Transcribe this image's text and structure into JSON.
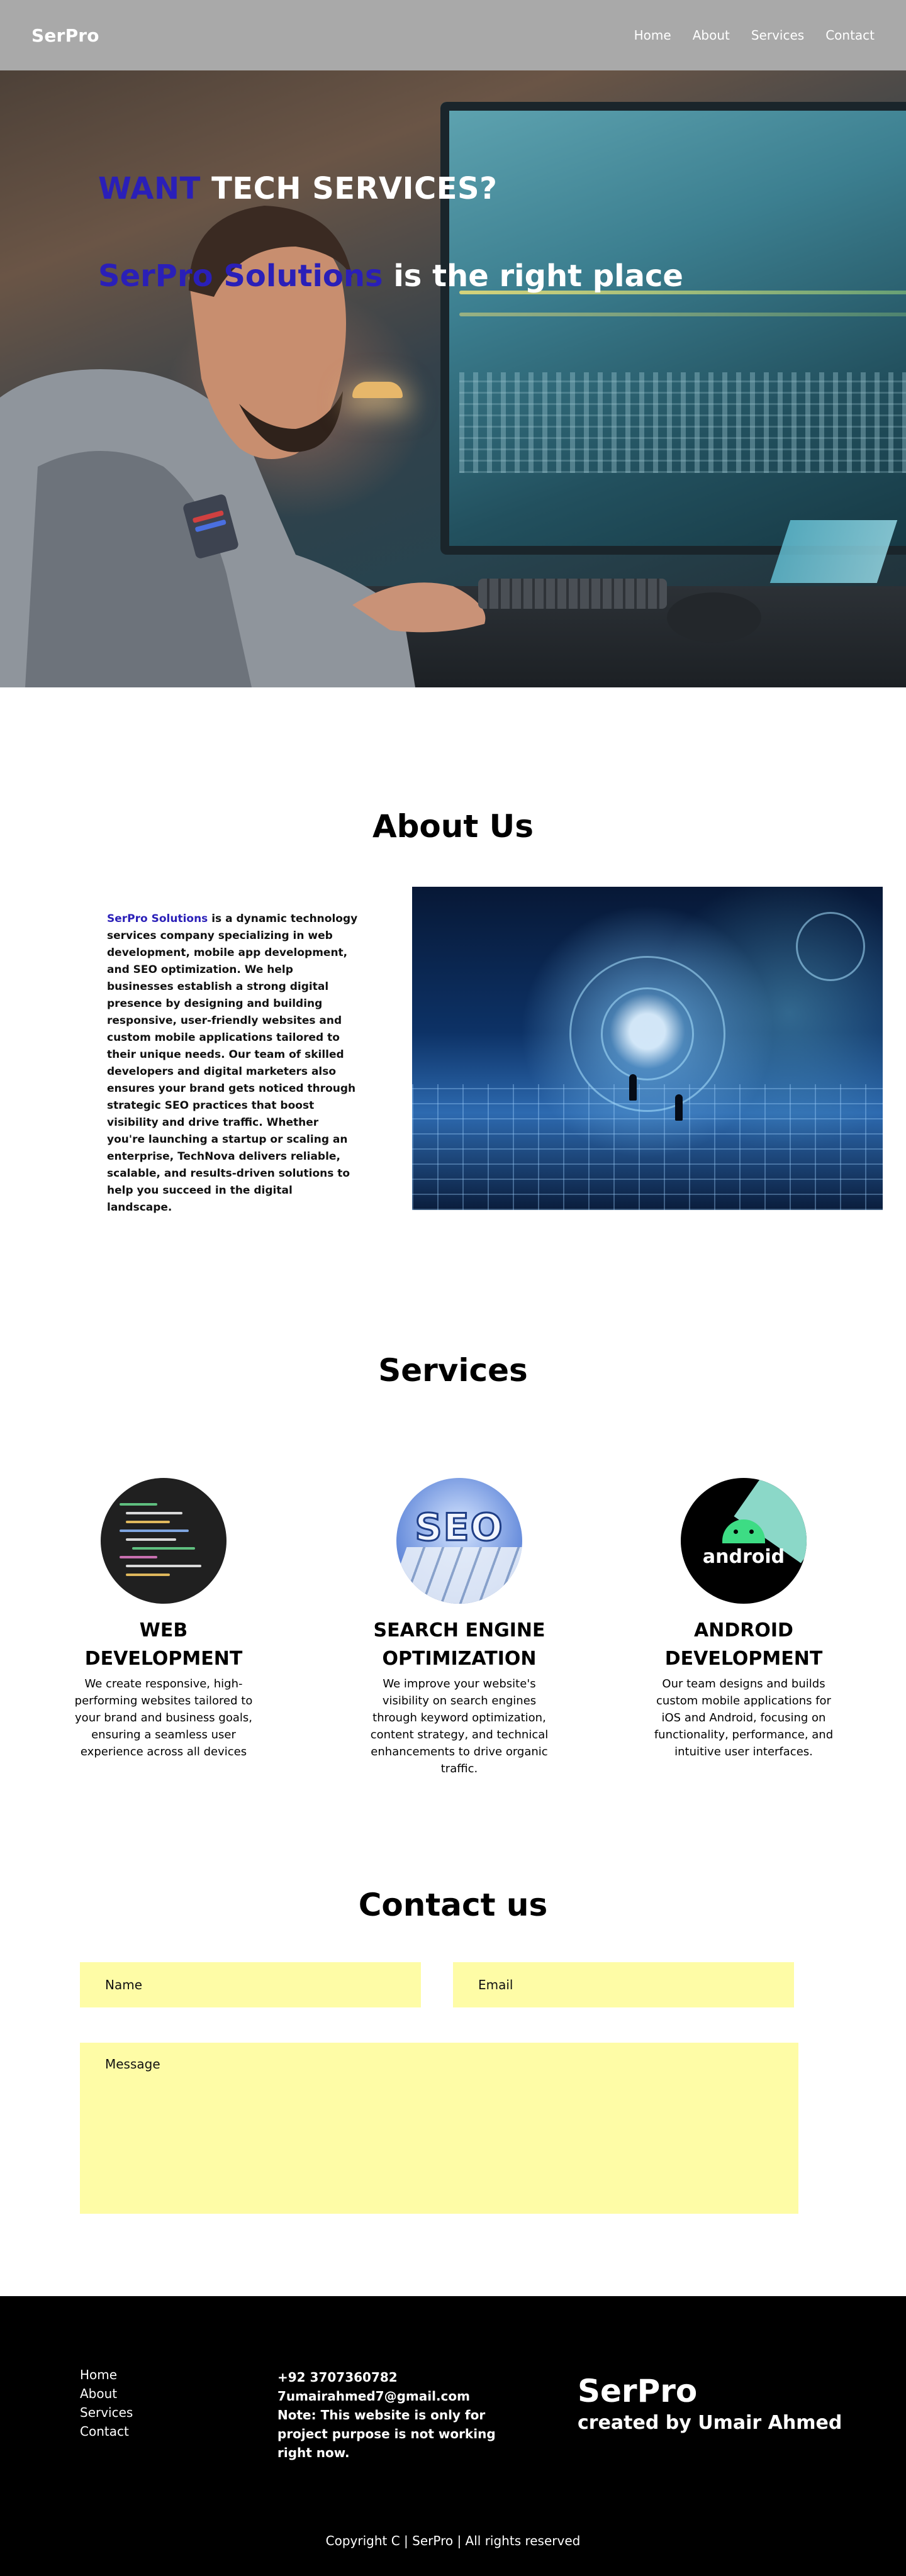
{
  "navbar": {
    "brand": "SerPro",
    "links": [
      "Home",
      "About",
      "Services",
      "Contact"
    ]
  },
  "hero": {
    "headline_accent": "WANT",
    "headline_rest": " TECH SERVICES?",
    "sub_accent": "SerPro Solutions",
    "sub_rest": " is the right place"
  },
  "about": {
    "title": "About Us",
    "accent": "SerPro Solutions",
    "text": " is a dynamic technology services company specializing in web development, mobile app development, and SEO optimization. We help businesses establish a strong digital presence by designing and building responsive, user-friendly websites and custom mobile applications tailored to their unique needs. Our team of skilled developers and digital marketers also ensures your brand gets noticed through strategic SEO practices that boost visibility and drive traffic. Whether you're launching a startup or scaling an enterprise, TechNova delivers reliable, scalable, and results-driven solutions to help you succeed in the digital landscape."
  },
  "services": {
    "title": "Services",
    "items": [
      {
        "title": "WEB DEVELOPMENT",
        "desc": "We create responsive, high-performing websites tailored to your brand and business goals, ensuring a seamless user experience across all devices"
      },
      {
        "title": "SEARCH ENGINE OPTIMIZATION",
        "desc": "We improve your website's visibility on search engines through keyword optimization, content strategy, and technical enhancements to drive organic traffic.",
        "image_text": "SEO"
      },
      {
        "title": "ANDROID DEVELOPMENT",
        "desc": "Our team designs and builds custom mobile applications for iOS and Android, focusing on functionality, performance, and intuitive user interfaces.",
        "image_text": "android"
      }
    ]
  },
  "contact": {
    "title": "Contact us",
    "name_placeholder": "Name",
    "email_placeholder": "Email",
    "message_placeholder": "Message"
  },
  "footer": {
    "links": [
      "Home",
      "About",
      "Services",
      "Contact"
    ],
    "phone": "+92 3707360782",
    "email": "7umairahmed7@gmail.com",
    "note": "Note: This website is only for project purpose is not working right now.",
    "brand": "SerPro",
    "created_by": "created by Umair Ahmed",
    "copyright": "Copyright C | SerPro | All rights reserved"
  },
  "colors": {
    "accent": "#2a1fb8",
    "navbar": "#a9a9a9",
    "field": "#fefca6",
    "footer": "#000000"
  }
}
